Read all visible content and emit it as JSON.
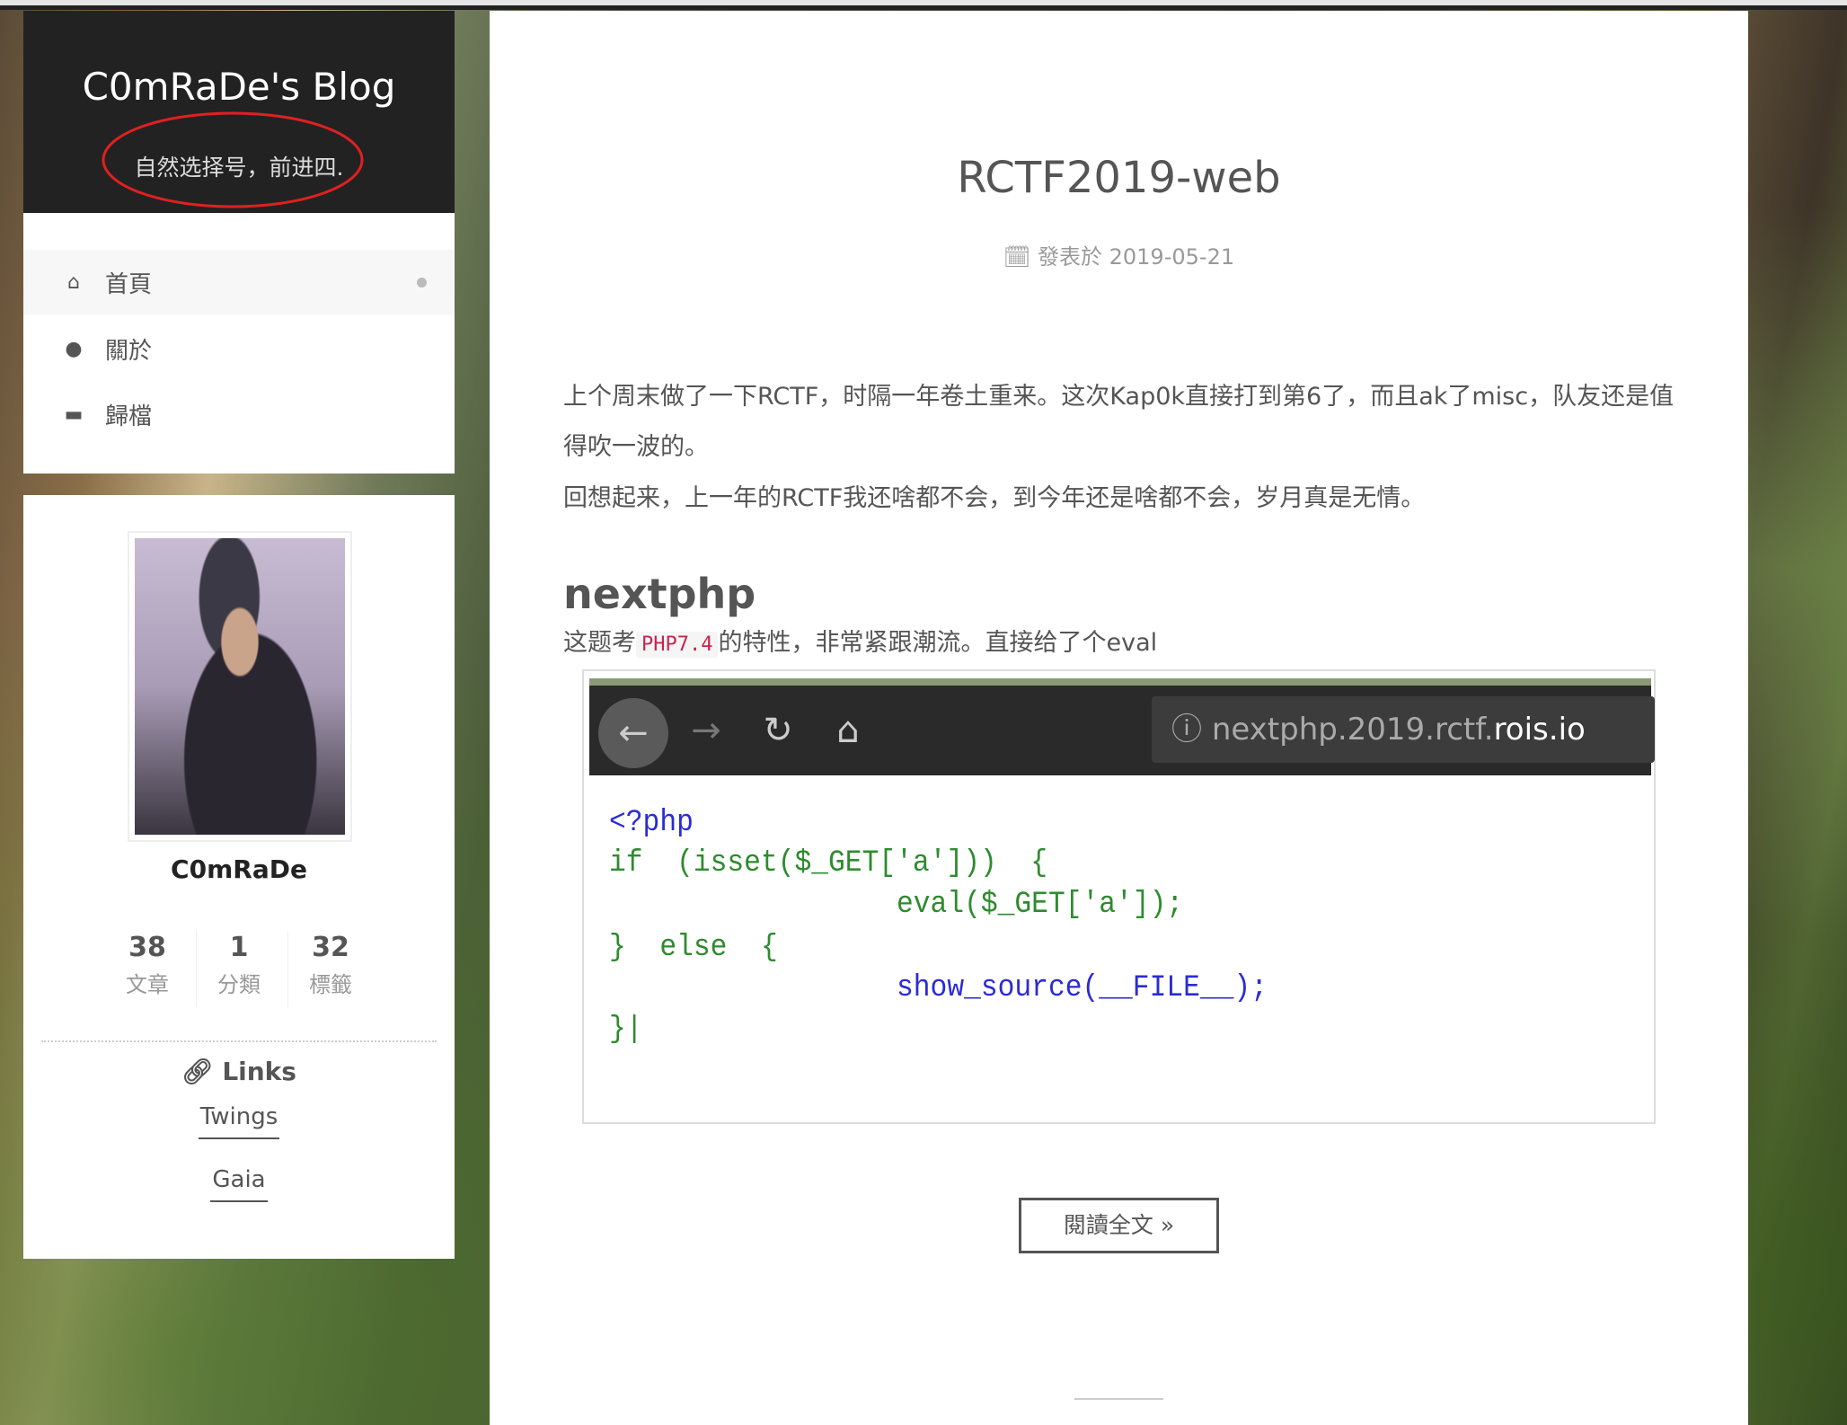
{
  "site": {
    "title": "C0mRaDe's Blog",
    "subtitle": "自然选择号，前进四.",
    "annotation_color": "#e02020"
  },
  "menu": {
    "items": [
      {
        "label": "首頁",
        "icon": "home-icon",
        "active": true
      },
      {
        "label": "關於",
        "icon": "user-icon"
      },
      {
        "label": "歸檔",
        "icon": "archive-icon"
      }
    ]
  },
  "profile": {
    "name": "C0mRaDe",
    "stats": [
      {
        "count": "38",
        "label": "文章"
      },
      {
        "count": "1",
        "label": "分類"
      },
      {
        "count": "32",
        "label": "標籤"
      }
    ],
    "links_title": "Links",
    "links": [
      "Twings",
      "Gaia"
    ]
  },
  "post": {
    "title": "RCTF2019-web",
    "meta_label": "發表於",
    "date": "2019-05-21",
    "para1": "上个周末做了一下RCTF，时隔一年卷土重来。这次Kap0k直接打到第6了，而且ak了misc，队友还是值得吹一波的。",
    "para2": "回想起来，上一年的RCTF我还啥都不会，到今年还是啥都不会，岁月真是无情。",
    "h2": "nextphp",
    "line_pre": "这题考",
    "line_code": "PHP7.4",
    "line_post": "的特性，非常紧跟潮流。直接给了个eval",
    "screenshot": {
      "url_prefix": "nextphp.2019.rctf.",
      "url_domain": "rois.io",
      "code": [
        "<?php",
        "if  (isset($_GET['a']))  {",
        "eval($_GET['a']);",
        "}  else  {",
        "show_source(__FILE__);",
        "}|"
      ]
    },
    "read_more": "閱讀全文 »"
  }
}
